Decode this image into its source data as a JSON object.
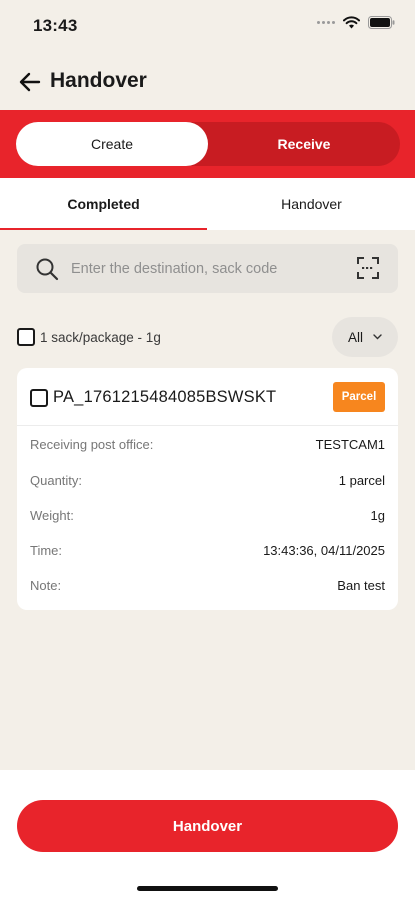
{
  "status_bar": {
    "time": "13:43"
  },
  "header": {
    "title": "Handover"
  },
  "segment": {
    "create": "Create",
    "receive": "Receive"
  },
  "tabs": {
    "completed": "Completed",
    "handover": "Handover"
  },
  "search": {
    "placeholder": "Enter the destination, sack code"
  },
  "selection": {
    "summary": "1 sack/package - 1g",
    "filter": "All"
  },
  "card": {
    "code": "PA_1761215484085BSWSKT",
    "badge": "Parcel",
    "rows": [
      {
        "label": "Receiving post office:",
        "value": "TESTCAM1"
      },
      {
        "label": "Quantity:",
        "value": "1 parcel"
      },
      {
        "label": "Weight:",
        "value": "1g"
      },
      {
        "label": "Time:",
        "value": "13:43:36, 04/11/2025"
      },
      {
        "label": "Note:",
        "value": "Ban test"
      }
    ]
  },
  "footer": {
    "button": "Handover"
  },
  "colors": {
    "accent": "#e8242b",
    "badge": "#f7861e",
    "background": "#f3efe8"
  }
}
